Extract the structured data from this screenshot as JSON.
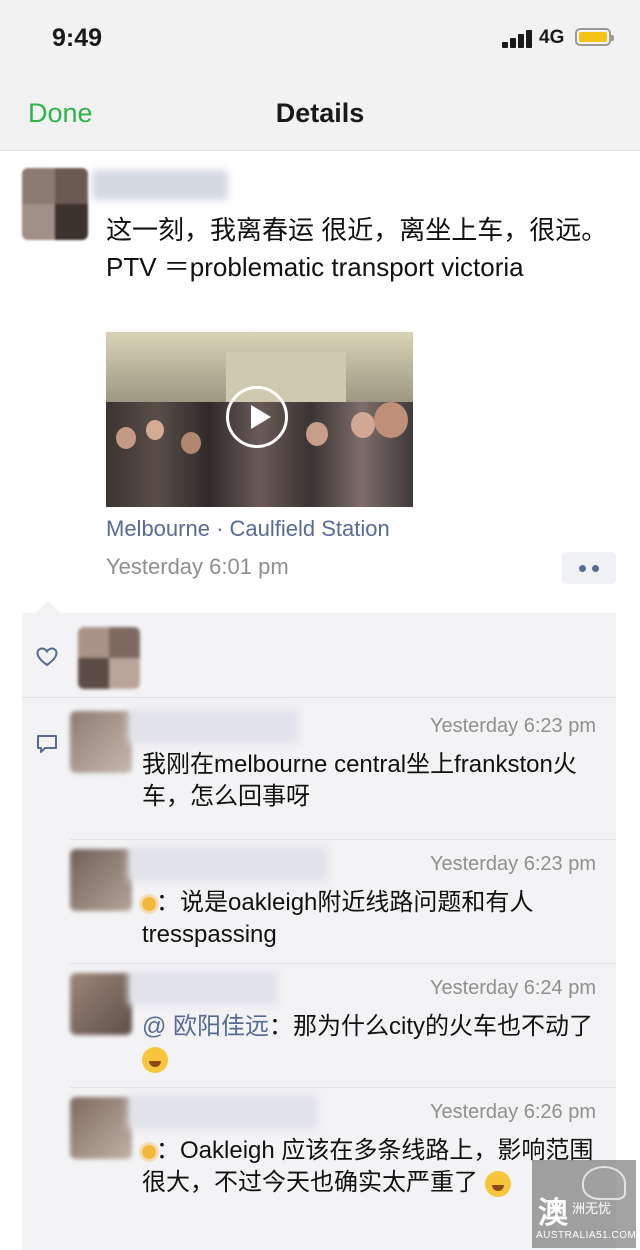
{
  "status_bar": {
    "time": "9:49",
    "network": "4G",
    "battery_color": "#f5c315"
  },
  "nav": {
    "done_label": "Done",
    "title": "Details",
    "accent": "#2fb34b"
  },
  "post": {
    "text": "这一刻，我离春运 很近，离坐上车，很远。 PTV ＝problematic transport victoria",
    "location": "Melbourne · Caulfield Station",
    "time": "Yesterday 6:01 pm"
  },
  "comments": [
    {
      "time": "Yesterday 6:23 pm",
      "text": "我刚在melbourne central坐上frankston火车，怎么回事呀"
    },
    {
      "time": "Yesterday 6:23 pm",
      "text": "：说是oakleigh附近线路问题和有人tresspassing"
    },
    {
      "time": "Yesterday 6:24 pm",
      "mention": "@ 欧阳佳远",
      "text": "：那为什么city的火车也不动了"
    },
    {
      "time": "Yesterday 6:26 pm",
      "text": "：Oakleigh 应该在多条线路上，影响范围很大，不过今天也确实太严重了"
    }
  ],
  "watermark": {
    "char": "澳",
    "cn": "洲无忧",
    "en": "AUSTRALIA51.COM"
  },
  "icons": [
    "signal-icon",
    "battery-icon",
    "play-icon",
    "more-icon",
    "heart-icon",
    "comment-icon"
  ]
}
